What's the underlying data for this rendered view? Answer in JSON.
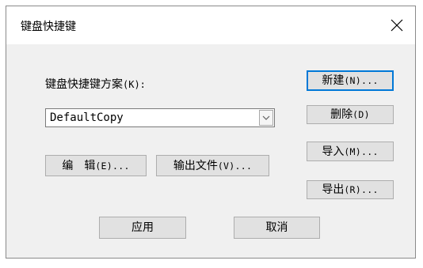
{
  "dialog": {
    "title": "键盘快捷键",
    "scheme_label_cjk": "键盘快捷键方案",
    "scheme_label_suffix": "(K):",
    "scheme_value": "DefaultCopy"
  },
  "buttons": {
    "new": {
      "cjk": "新建",
      "suffix": "(N)..."
    },
    "delete": {
      "cjk": "删除",
      "suffix": "(D)"
    },
    "import": {
      "cjk": "导入",
      "suffix": "(M)..."
    },
    "export": {
      "cjk": "导出",
      "suffix": "(R)..."
    },
    "edit": {
      "cjk": "编　辑",
      "suffix": "(E)..."
    },
    "output": {
      "cjk": "输出文件",
      "suffix": "(V)..."
    },
    "apply": "应用",
    "cancel": "取消"
  },
  "icons": {
    "close": "close-icon",
    "dropdown": "chevron-down-icon"
  },
  "colors": {
    "accent": "#0078d7",
    "dialog_bg": "#f0f0f0",
    "button_bg": "#e1e1e1"
  }
}
